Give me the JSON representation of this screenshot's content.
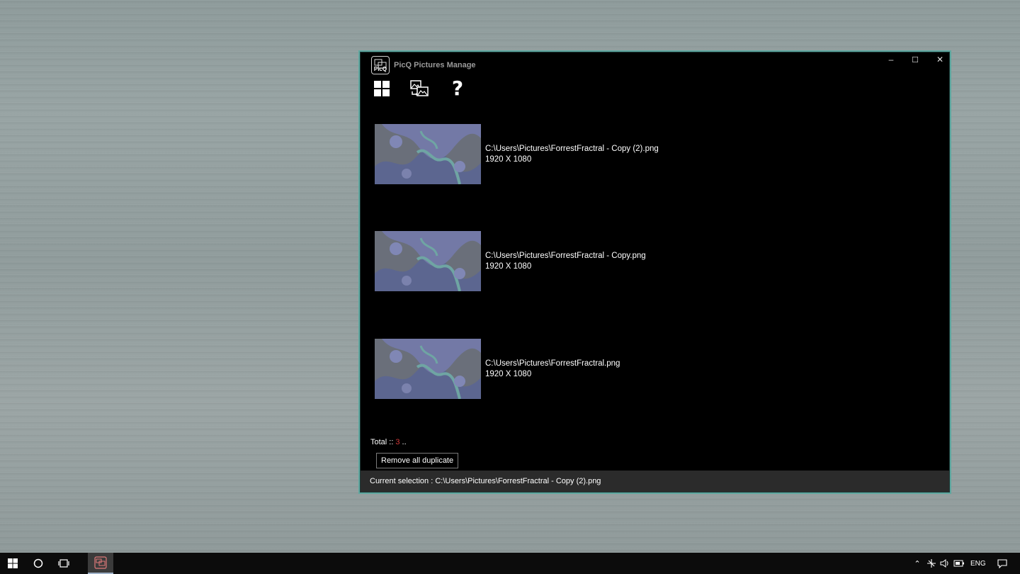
{
  "window": {
    "title": "PicQ Pictures Manage",
    "logo_text": "PicQ",
    "controls": {
      "minimize": "–",
      "maximize": "☐",
      "close": "✕"
    }
  },
  "toolbar": {
    "icons": [
      "grid-view-icon",
      "compare-images-icon",
      "help-icon"
    ]
  },
  "duplicates": [
    {
      "path": "C:\\Users\\Pictures\\ForrestFractral - Copy (2).png",
      "dimensions": "1920 X 1080"
    },
    {
      "path": "C:\\Users\\Pictures\\ForrestFractral - Copy.png",
      "dimensions": "1920 X 1080"
    },
    {
      "path": "C:\\Users\\Pictures\\ForrestFractral.png",
      "dimensions": "1920 X 1080"
    }
  ],
  "summary": {
    "total_label": "Total ::",
    "total_count": "3",
    "total_suffix": ".."
  },
  "actions": {
    "remove_all_label": "Remove all duplicate"
  },
  "status": {
    "current_selection": "Current selection : C:\\Users\\Pictures\\ForrestFractral - Copy (2).png"
  },
  "taskbar": {
    "language": "ENG"
  },
  "colors": {
    "window_border": "#5fa8a0",
    "count_accent": "#d23a3a",
    "statusbar_bg": "#2b2b2b"
  }
}
